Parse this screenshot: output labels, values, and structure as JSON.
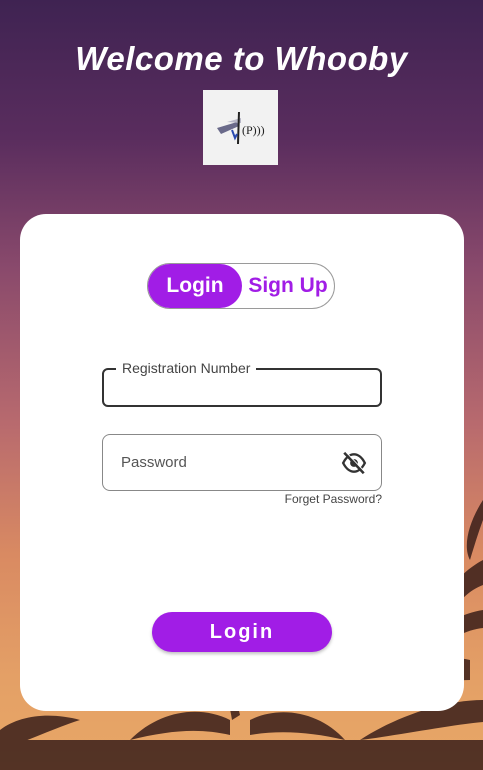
{
  "header": {
    "title": "Welcome to Whooby"
  },
  "tabs": {
    "login_label": "Login",
    "signup_label": "Sign Up",
    "active": "Login"
  },
  "form": {
    "registration_label": "Registration Number",
    "registration_value": "",
    "password_placeholder": "Password",
    "password_value": "",
    "password_visibility_icon": "eye-off-icon",
    "forgot_label": "Forget Password?",
    "submit_label": "Login"
  },
  "colors": {
    "accent": "#a11de6",
    "card": "#ffffff"
  }
}
